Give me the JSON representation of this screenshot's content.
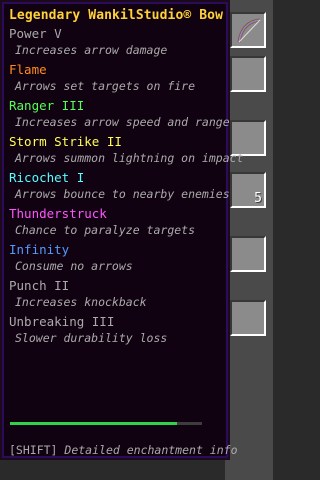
{
  "tooltip": {
    "title": "Legendary WankilStudio® Bow",
    "title_color": "#ffd23a",
    "enchantments": [
      {
        "name": "Power V",
        "desc": "Increases arrow damage",
        "color": "#aaaaaa"
      },
      {
        "name": "Flame",
        "desc": "Arrows set targets on fire",
        "color": "#ff8c1a"
      },
      {
        "name": "Ranger III",
        "desc": "Increases arrow speed and range",
        "color": "#55ff55"
      },
      {
        "name": "Storm Strike II",
        "desc": "Arrows summon lightning on impact",
        "color": "#ffff55"
      },
      {
        "name": "Ricochet I",
        "desc": "Arrows bounce to nearby enemies",
        "color": "#55ffff"
      },
      {
        "name": "Thunderstruck",
        "desc": "Chance to paralyze targets",
        "color": "#ff55ff"
      },
      {
        "name": "Infinity",
        "desc": "Consume no arrows",
        "color": "#5599ff"
      },
      {
        "name": "Punch II",
        "desc": "Increases knockback",
        "color": "#aaaaaa"
      },
      {
        "name": "Unbreaking III",
        "desc": "Slower durability loss",
        "color": "#aaaaaa"
      }
    ],
    "durability_fraction": 0.87,
    "durability_color": "#2fd24a",
    "hint_key": "[SHIFT]",
    "hint_text": "Detailed enchantment info"
  },
  "inventory": {
    "slot_count": "5",
    "held_item_icon": "bow-icon"
  }
}
